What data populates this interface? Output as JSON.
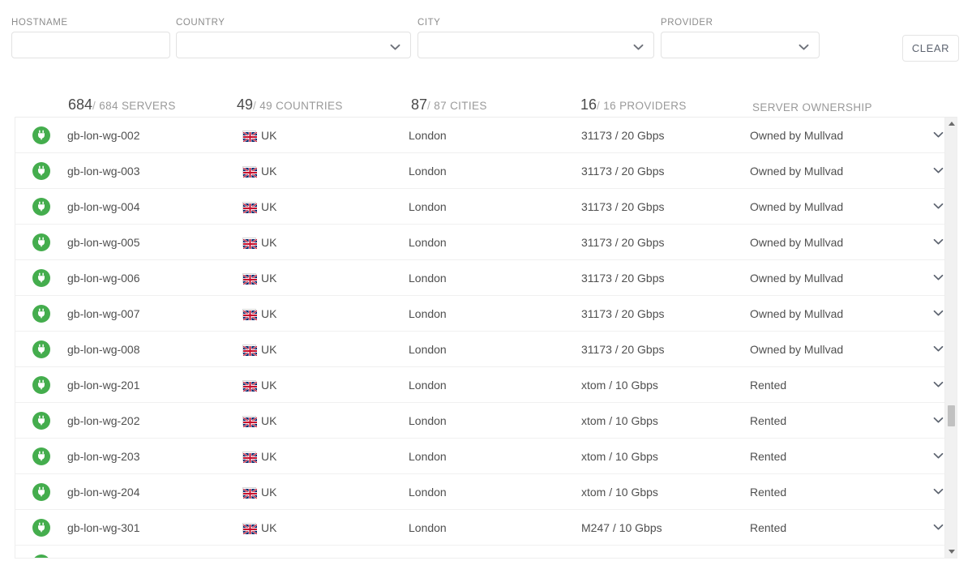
{
  "filters": {
    "hostname": {
      "label": "HOSTNAME",
      "value": "",
      "placeholder": ""
    },
    "country": {
      "label": "COUNTRY",
      "value": "",
      "options": [
        ""
      ]
    },
    "city": {
      "label": "CITY",
      "value": "",
      "options": [
        ""
      ]
    },
    "provider": {
      "label": "PROVIDER",
      "value": "",
      "options": [
        ""
      ]
    },
    "clear_label": "CLEAR"
  },
  "stats": {
    "servers": {
      "count": "684",
      "sep": "/",
      "total": "684 SERVERS"
    },
    "countries": {
      "count": "49",
      "sep": "/",
      "total": "49 COUNTRIES"
    },
    "cities": {
      "count": "87",
      "sep": "/",
      "total": "87 CITIES"
    },
    "providers": {
      "count": "16",
      "sep": "/",
      "total": "16 PROVIDERS"
    },
    "ownership_label": "SERVER OWNERSHIP"
  },
  "colors": {
    "status_online": "#44ad4d",
    "text": "#4f4f4f",
    "muted": "#9a9a9a",
    "border": "#f0f0f0",
    "scrollbar_thumb": "#c1c1c1"
  },
  "table": {
    "rows": [
      {
        "status": "online",
        "hostname": "gb-lon-wg-002",
        "country": "UK",
        "city": "London",
        "provider": "31173 / 20 Gbps",
        "ownership": "Owned by Mullvad"
      },
      {
        "status": "online",
        "hostname": "gb-lon-wg-003",
        "country": "UK",
        "city": "London",
        "provider": "31173 / 20 Gbps",
        "ownership": "Owned by Mullvad"
      },
      {
        "status": "online",
        "hostname": "gb-lon-wg-004",
        "country": "UK",
        "city": "London",
        "provider": "31173 / 20 Gbps",
        "ownership": "Owned by Mullvad"
      },
      {
        "status": "online",
        "hostname": "gb-lon-wg-005",
        "country": "UK",
        "city": "London",
        "provider": "31173 / 20 Gbps",
        "ownership": "Owned by Mullvad"
      },
      {
        "status": "online",
        "hostname": "gb-lon-wg-006",
        "country": "UK",
        "city": "London",
        "provider": "31173 / 20 Gbps",
        "ownership": "Owned by Mullvad"
      },
      {
        "status": "online",
        "hostname": "gb-lon-wg-007",
        "country": "UK",
        "city": "London",
        "provider": "31173 / 20 Gbps",
        "ownership": "Owned by Mullvad"
      },
      {
        "status": "online",
        "hostname": "gb-lon-wg-008",
        "country": "UK",
        "city": "London",
        "provider": "31173 / 20 Gbps",
        "ownership": "Owned by Mullvad"
      },
      {
        "status": "online",
        "hostname": "gb-lon-wg-201",
        "country": "UK",
        "city": "London",
        "provider": "xtom / 10 Gbps",
        "ownership": "Rented"
      },
      {
        "status": "online",
        "hostname": "gb-lon-wg-202",
        "country": "UK",
        "city": "London",
        "provider": "xtom / 10 Gbps",
        "ownership": "Rented"
      },
      {
        "status": "online",
        "hostname": "gb-lon-wg-203",
        "country": "UK",
        "city": "London",
        "provider": "xtom / 10 Gbps",
        "ownership": "Rented"
      },
      {
        "status": "online",
        "hostname": "gb-lon-wg-204",
        "country": "UK",
        "city": "London",
        "provider": "xtom / 10 Gbps",
        "ownership": "Rented"
      },
      {
        "status": "online",
        "hostname": "gb-lon-wg-301",
        "country": "UK",
        "city": "London",
        "provider": "M247 / 10 Gbps",
        "ownership": "Rented"
      },
      {
        "status": "online",
        "hostname": "",
        "country": "",
        "city": "",
        "provider": "",
        "ownership": ""
      }
    ]
  }
}
